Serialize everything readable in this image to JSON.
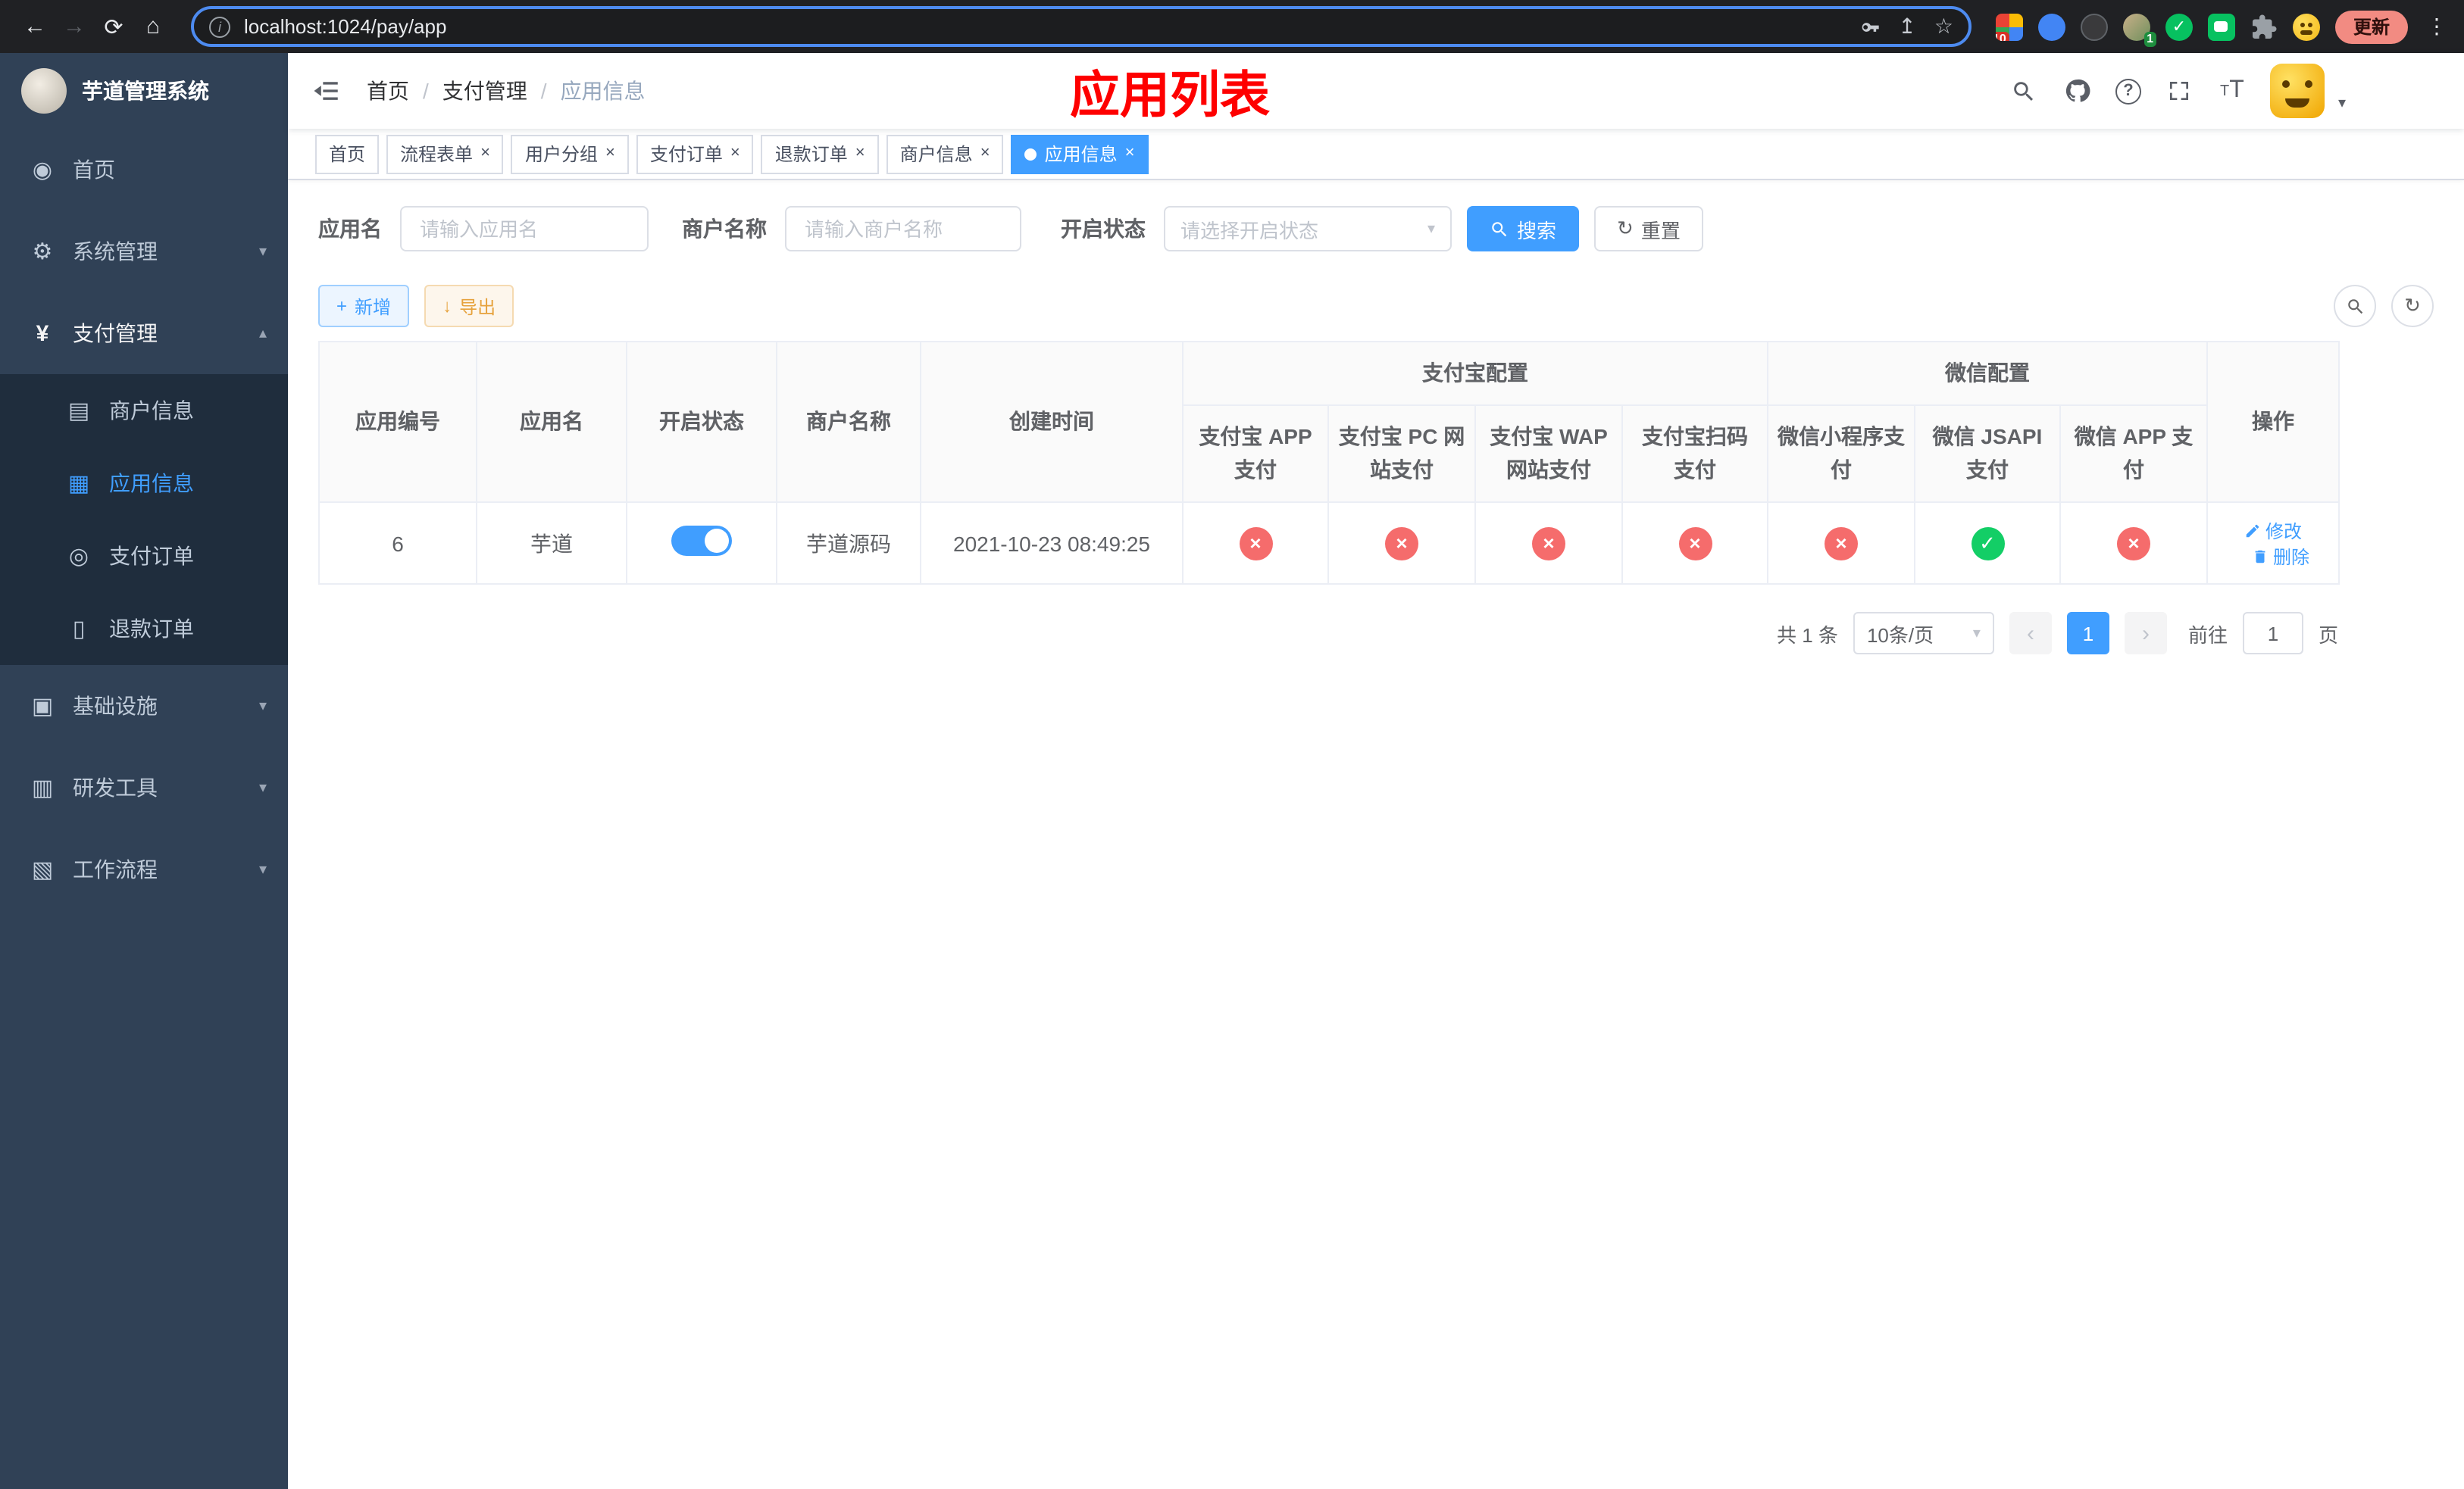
{
  "colors": {
    "accent": "#409EFF",
    "danger": "#F56C6C",
    "success": "#13CE66",
    "title_red": "#FE0000"
  },
  "browser": {
    "url": "localhost:1024/pay/app",
    "update_label": "更新",
    "ext_badge_grid": "10",
    "ext_badge_avatar": "1"
  },
  "sidebar": {
    "title": "芋道管理系统",
    "items": [
      {
        "label": "首页"
      },
      {
        "label": "系统管理"
      },
      {
        "label": "支付管理"
      },
      {
        "label": "商户信息"
      },
      {
        "label": "应用信息"
      },
      {
        "label": "支付订单"
      },
      {
        "label": "退款订单"
      },
      {
        "label": "基础设施"
      },
      {
        "label": "研发工具"
      },
      {
        "label": "工作流程"
      }
    ]
  },
  "navbar": {
    "breadcrumb": {
      "home": "首页",
      "parent": "支付管理",
      "current": "应用信息"
    },
    "page_title": "应用列表"
  },
  "tabs": [
    {
      "label": "首页"
    },
    {
      "label": "流程表单"
    },
    {
      "label": "用户分组"
    },
    {
      "label": "支付订单"
    },
    {
      "label": "退款订单"
    },
    {
      "label": "商户信息"
    },
    {
      "label": "应用信息"
    }
  ],
  "filters": {
    "app_name_label": "应用名",
    "app_name_placeholder": "请输入应用名",
    "merchant_label": "商户名称",
    "merchant_placeholder": "请输入商户名称",
    "status_label": "开启状态",
    "status_placeholder": "请选择开启状态",
    "search_button": "搜索",
    "reset_button": "重置"
  },
  "toolbar": {
    "add_button": "新增",
    "export_button": "导出"
  },
  "table": {
    "headers": {
      "app_id": "应用编号",
      "app_name": "应用名",
      "status": "开启状态",
      "merchant": "商户名称",
      "created": "创建时间",
      "alipay_group": "支付宝配置",
      "wechat_group": "微信配置",
      "alipay_app": "支付宝 APP 支付",
      "alipay_pc": "支付宝 PC 网站支付",
      "alipay_wap": "支付宝 WAP 网站支付",
      "alipay_qr": "支付宝扫码支付",
      "wx_lite": "微信小程序支付",
      "wx_jsapi": "微信 JSAPI 支付",
      "wx_app": "微信 APP 支付",
      "actions": "操作"
    },
    "row": {
      "id": "6",
      "name": "芋道",
      "switch": "on",
      "merchant": "芋道源码",
      "created": "2021-10-23 08:49:25",
      "statuses": {
        "alipay_app": "off",
        "alipay_pc": "off",
        "alipay_wap": "off",
        "alipay_qr": "off",
        "wx_lite": "off",
        "wx_jsapi": "on",
        "wx_app": "off"
      },
      "edit": "修改",
      "delete": "删除"
    }
  },
  "pagination": {
    "total": "共 1 条",
    "size": "10条/页",
    "page": "1",
    "goto_label": "前往",
    "goto_value": "1",
    "unit": "页"
  }
}
